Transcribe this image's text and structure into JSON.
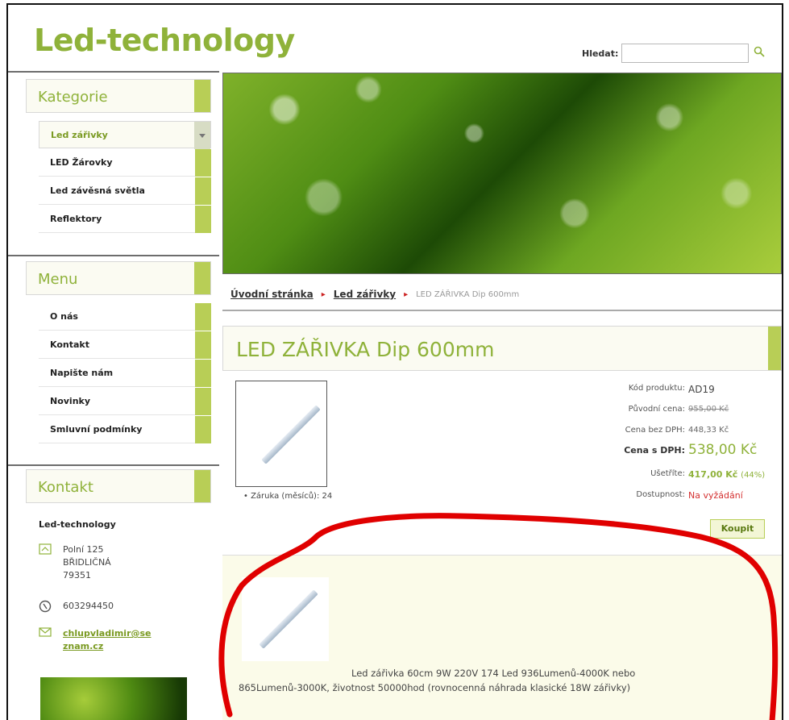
{
  "header": {
    "logo": "Led-technology",
    "search_label": "Hledat:",
    "search_value": ""
  },
  "sidebar": {
    "categories_title": "Kategorie",
    "categories": [
      {
        "label": "Led zářivky",
        "active": true
      },
      {
        "label": "LED Žárovky",
        "active": false
      },
      {
        "label": "Led závěsná světla",
        "active": false
      },
      {
        "label": "Reflektory",
        "active": false
      }
    ],
    "menu_title": "Menu",
    "menu": [
      {
        "label": "O nás"
      },
      {
        "label": "Kontakt"
      },
      {
        "label": "Napište nám"
      },
      {
        "label": "Novinky"
      },
      {
        "label": "Smluvní podmínky"
      }
    ],
    "contact_title": "Kontakt",
    "contact": {
      "name": "Led-technology",
      "address": "Polní 125\nBŘIDLIČNÁ\n79351",
      "phone": "603294450",
      "email": "chlupvladimir@seznam.cz"
    }
  },
  "breadcrumb": {
    "home": "Úvodní stránka",
    "category": "Led zářivky",
    "current": "LED ZÁŘIVKA Dip 600mm"
  },
  "product": {
    "title": "LED ZÁŘIVKA Dip 600mm",
    "warranty": "• Záruka (měsíců): 24",
    "specs": {
      "code_label": "Kód produktu:",
      "code_value": "AD19",
      "orig_label": "Původní cena:",
      "orig_value": "955,00 Kč",
      "net_label": "Cena bez DPH:",
      "net_value": "448,33 Kč",
      "gross_label": "Cena s DPH:",
      "gross_value": "538,00 Kč",
      "save_label": "Ušetříte:",
      "save_value": "417,00 Kč",
      "save_pct": "(44%)",
      "avail_label": "Dostupnost:",
      "avail_value": "Na vyžádání"
    },
    "buy_label": "Koupit",
    "description_line1": "Led zářivka 60cm 9W 220V 174 Led 936Lumenů-4000K nebo",
    "description_line2": "865Lumenů-3000K, životnost 50000hod (rovnocenná náhrada klasické 18W zářivky)"
  },
  "colors": {
    "brand_green": "#8fb23a",
    "tab_green": "#b8ce56",
    "annotation_red": "#e00000"
  }
}
